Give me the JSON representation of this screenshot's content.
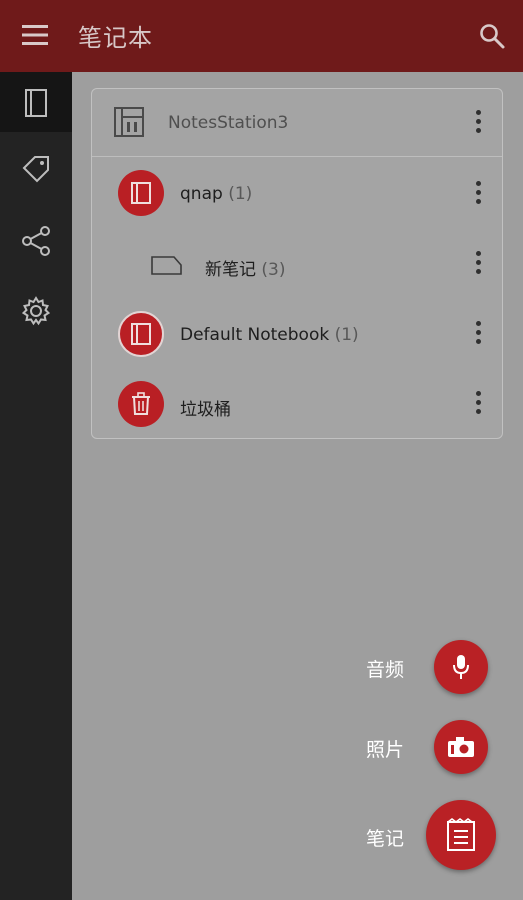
{
  "appbar": {
    "title": "笔记本"
  },
  "colors": {
    "appbar": "#6f1a1a",
    "accent": "#b91f24",
    "rail": "#232323",
    "overlay": "#9e9e9e"
  },
  "rail": {
    "items": [
      "notebook-icon",
      "tag-icon",
      "share-icon",
      "gear-icon"
    ]
  },
  "card": {
    "station": "NotesStation3",
    "rows": [
      {
        "name": "qnap",
        "count": "(1)",
        "icon": "notebook-icon"
      },
      {
        "name": "新笔记",
        "count": "(3)",
        "icon": "tag-shape-icon"
      },
      {
        "name": "Default Notebook",
        "count": "(1)",
        "icon": "notebook-icon"
      },
      {
        "name": "垃圾桶",
        "count": "",
        "icon": "trash-icon"
      }
    ]
  },
  "fabs": {
    "audio": "音频",
    "photo": "照片",
    "note": "笔记"
  }
}
